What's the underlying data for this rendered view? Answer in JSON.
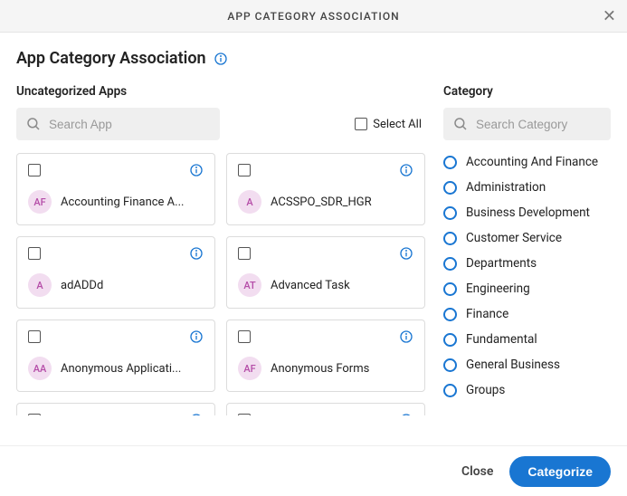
{
  "header": {
    "title": "APP CATEGORY ASSOCIATION"
  },
  "subtitle": "App Category Association",
  "left": {
    "heading": "Uncategorized Apps",
    "search_placeholder": "Search App",
    "select_all_label": "Select All",
    "apps": [
      {
        "initials": "AF",
        "label": "Accounting Finance A..."
      },
      {
        "initials": "A",
        "label": "ACSSPO_SDR_HGR"
      },
      {
        "initials": "A",
        "label": "adADDd"
      },
      {
        "initials": "AT",
        "label": "Advanced Task"
      },
      {
        "initials": "AA",
        "label": "Anonymous Applicati..."
      },
      {
        "initials": "AF",
        "label": "Anonymous Forms"
      },
      {
        "initials": "",
        "label": ""
      },
      {
        "initials": "",
        "label": ""
      }
    ]
  },
  "right": {
    "heading": "Category",
    "search_placeholder": "Search Category",
    "categories": [
      "Accounting And Finance",
      "Administration",
      "Business Development",
      "Customer Service",
      "Departments",
      "Engineering",
      "Finance",
      "Fundamental",
      "General Business",
      "Groups"
    ]
  },
  "footer": {
    "close": "Close",
    "categorize": "Categorize"
  }
}
